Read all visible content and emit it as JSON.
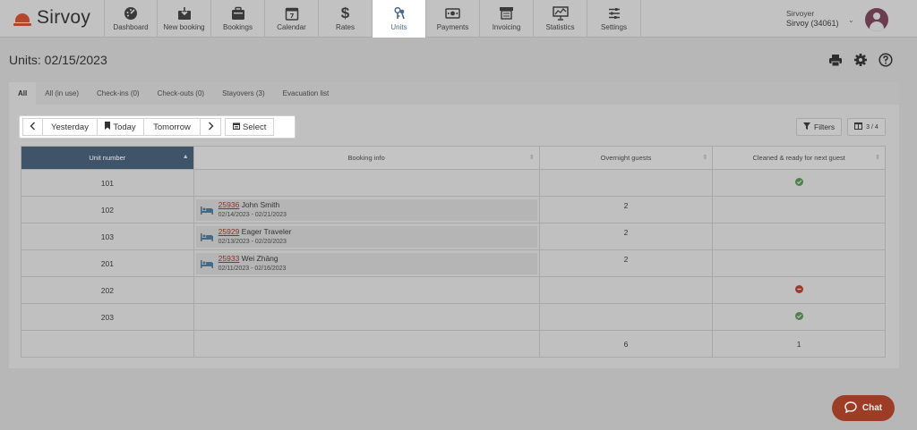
{
  "brand": {
    "name": "Sirvoy"
  },
  "nav": [
    {
      "label": "Dashboard",
      "icon": "dashboard-icon"
    },
    {
      "label": "New booking",
      "icon": "new-booking-icon"
    },
    {
      "label": "Bookings",
      "icon": "bookings-icon"
    },
    {
      "label": "Calendar",
      "icon": "calendar-icon"
    },
    {
      "label": "Rates",
      "icon": "dollar-icon"
    },
    {
      "label": "Units",
      "icon": "keys-icon",
      "active": true
    },
    {
      "label": "Payments",
      "icon": "payments-icon"
    },
    {
      "label": "Invoicing",
      "icon": "invoicing-icon"
    },
    {
      "label": "Statistics",
      "icon": "statistics-icon"
    },
    {
      "label": "Settings",
      "icon": "settings-icon"
    }
  ],
  "user": {
    "line1": "Sirvoyer",
    "line2": "Sirvoy (34061)"
  },
  "page": {
    "title": "Units: 02/15/2023"
  },
  "tabs": [
    "All",
    "All (in use)",
    "Check-ins (0)",
    "Check-outs (0)",
    "Stayovers (3)",
    "Evacuation list"
  ],
  "toolbar": {
    "yesterday": "Yesterday",
    "today": "Today",
    "tomorrow": "Tomorrow",
    "select": "Select"
  },
  "filters": {
    "label": "Filters",
    "columns": "3 / 4"
  },
  "table": {
    "headers": [
      "Unit number",
      "Booking info",
      "Overnight guests",
      "Cleaned & ready for next guest"
    ],
    "rows": [
      {
        "unit": "101",
        "booking": null,
        "guests": "",
        "clean": "ok"
      },
      {
        "unit": "102",
        "booking": {
          "id": "25936",
          "name": "John Smith",
          "dates": "02/14/2023 - 02/21/2023"
        },
        "guests": "2",
        "clean": ""
      },
      {
        "unit": "103",
        "booking": {
          "id": "25929",
          "name": "Eager Traveler",
          "dates": "02/13/2023 - 02/20/2023"
        },
        "guests": "2",
        "clean": ""
      },
      {
        "unit": "201",
        "booking": {
          "id": "25933",
          "name": "Wei Zhāng",
          "dates": "02/11/2023 - 02/16/2023"
        },
        "guests": "2",
        "clean": ""
      },
      {
        "unit": "202",
        "booking": null,
        "guests": "",
        "clean": "no"
      },
      {
        "unit": "203",
        "booking": null,
        "guests": "",
        "clean": "ok"
      }
    ],
    "totals": {
      "guests": "6",
      "clean": "1"
    }
  },
  "chat": {
    "label": "Chat"
  },
  "colors": {
    "brand": "#b4462b",
    "header_sorted": "#3f5468",
    "link": "#8d2f24",
    "ok": "#4f7f4a",
    "no": "#9b3a26"
  }
}
